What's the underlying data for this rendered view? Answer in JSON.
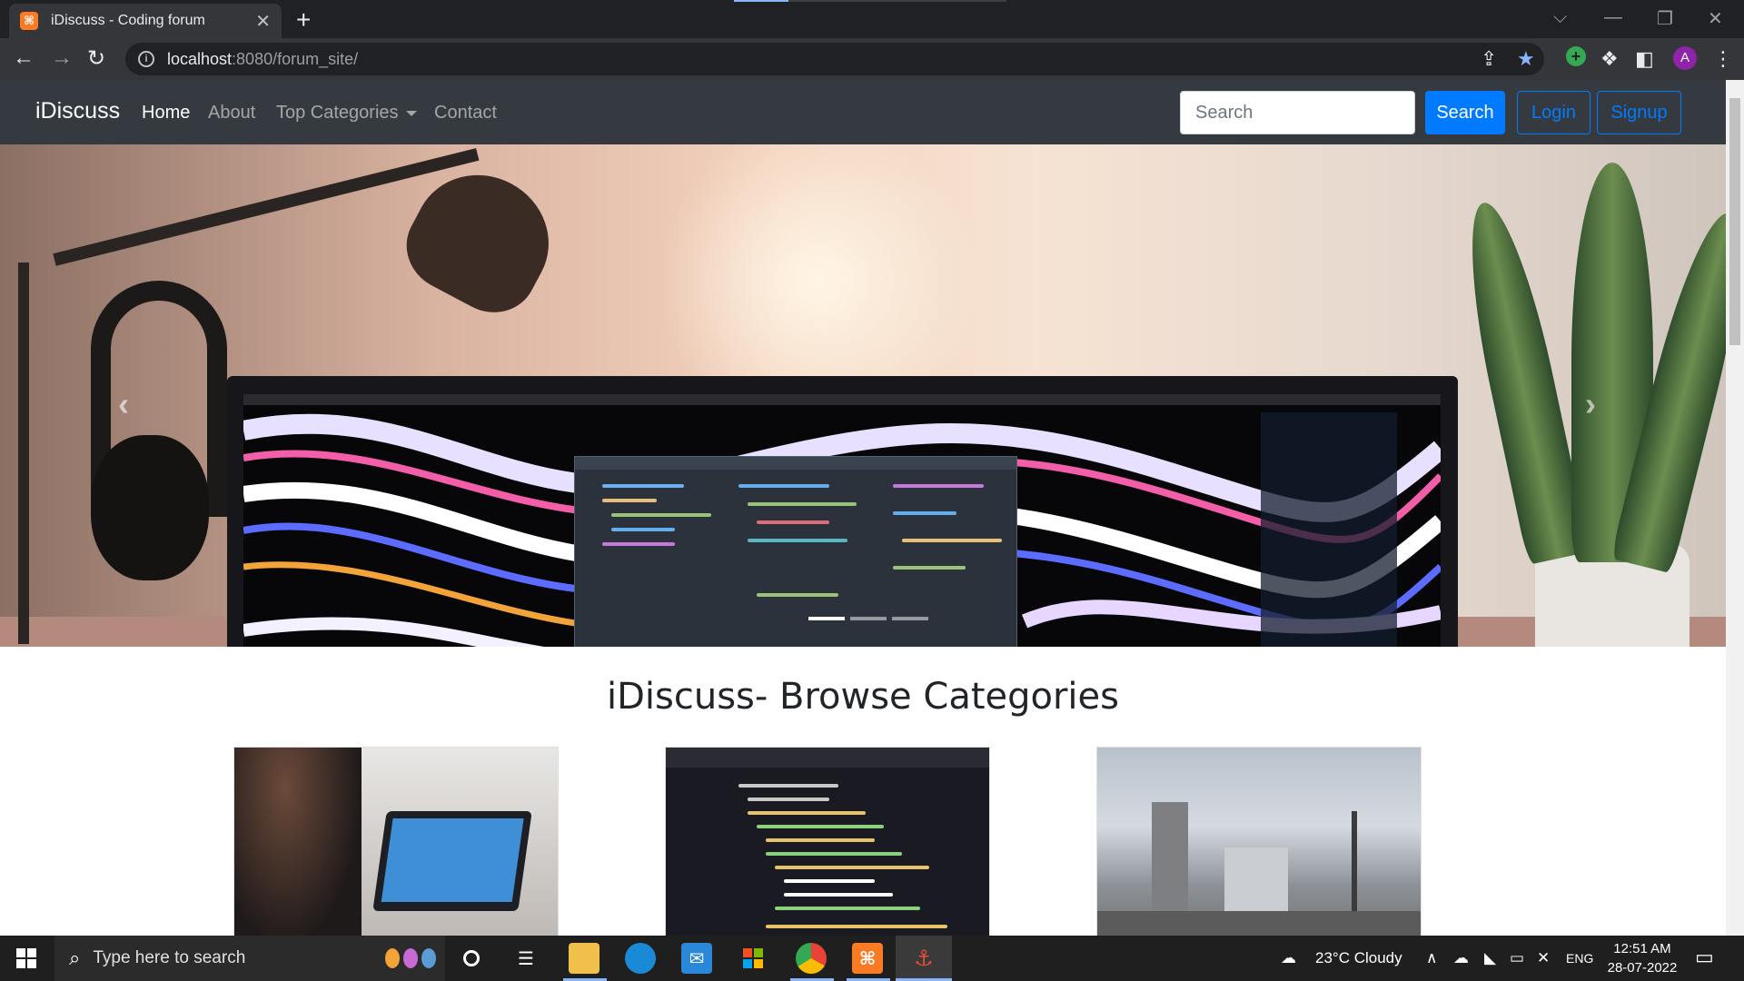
{
  "browser": {
    "tab_title": "iDiscuss - Coding forum",
    "tab_favicon": "xampp-icon",
    "url_host": "localhost",
    "url_path": ":8080/forum_site/",
    "profile_initial": "A"
  },
  "site": {
    "brand": "iDiscuss",
    "nav": {
      "home": "Home",
      "about": "About",
      "top_categories": "Top Categories",
      "contact": "Contact"
    },
    "search_placeholder": "Search",
    "search_button": "Search",
    "login_button": "Login",
    "signup_button": "Signup"
  },
  "carousel": {
    "slide_count": 3,
    "active_slide": 1
  },
  "categories": {
    "heading": "iDiscuss- Browse Categories"
  },
  "taskbar": {
    "search_placeholder": "Type here to search",
    "weather": "23°C  Cloudy",
    "language": "ENG",
    "time": "12:51 AM",
    "date": "28-07-2022"
  },
  "colors": {
    "navbar": "#343a40",
    "primary": "#007bff",
    "browser_frame": "#202124"
  }
}
